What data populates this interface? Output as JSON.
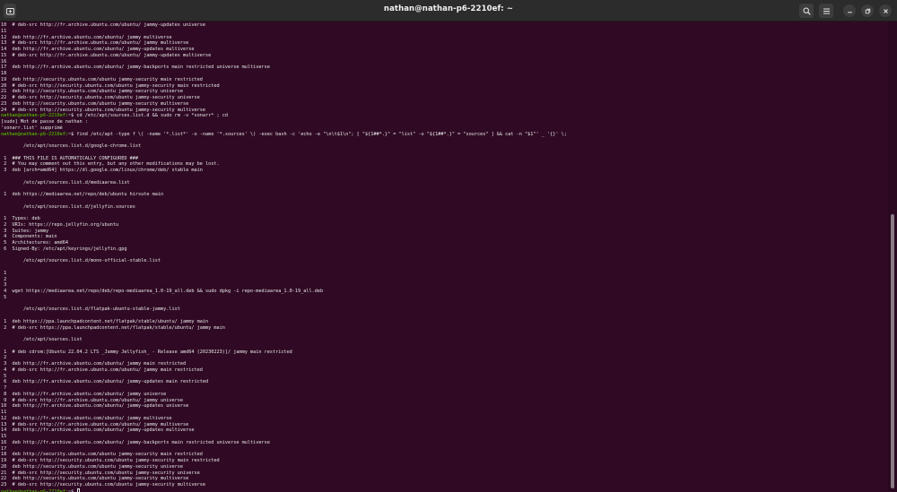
{
  "window": {
    "title": "nathan@nathan-p6-2210ef: ~",
    "icons": [
      "new-tab-icon",
      "search-icon",
      "menu-icon",
      "minimize-icon",
      "restore-icon",
      "close-icon"
    ]
  },
  "colors": {
    "background": "#300a24",
    "prompt": "#4e9a06",
    "text": "#e6e6e6"
  },
  "terminal": {
    "prompt": "nathan@nathan-p6-2210ef:",
    "lines": [
      {
        "text": "10  # deb-src http://fr.archive.ubuntu.com/ubuntu/ jammy-updates universe"
      },
      {
        "text": "11"
      },
      {
        "text": "12  deb http://fr.archive.ubuntu.com/ubuntu/ jammy multiverse"
      },
      {
        "text": "13  # deb-src http://fr.archive.ubuntu.com/ubuntu/ jammy multiverse"
      },
      {
        "text": "14  deb http://fr.archive.ubuntu.com/ubuntu/ jammy-updates multiverse"
      },
      {
        "text": "15  # deb-src http://fr.archive.ubuntu.com/ubuntu/ jammy-updates multiverse"
      },
      {
        "text": "16"
      },
      {
        "text": "17  deb http://fr.archive.ubuntu.com/ubuntu/ jammy-backports main restricted universe multiverse"
      },
      {
        "text": "18"
      },
      {
        "text": "19  deb http://security.ubuntu.com/ubuntu jammy-security main restricted"
      },
      {
        "text": "20  # deb-src http://security.ubuntu.com/ubuntu jammy-security main restricted"
      },
      {
        "text": "21  deb http://security.ubuntu.com/ubuntu jammy-security universe"
      },
      {
        "text": "22  # deb-src http://security.ubuntu.com/ubuntu jammy-security universe"
      },
      {
        "text": "23  deb http://security.ubuntu.com/ubuntu jammy-security multiverse"
      },
      {
        "text": "24  # deb-src http://security.ubuntu.com/ubuntu jammy-security multiverse"
      },
      {
        "prompt": "nathan@nathan-p6-2210ef:",
        "text": "~$ cd /etc/apt/sources.list.d && sudo rm -v *sonarr* ; cd"
      },
      {
        "text": "[sudo] Mot de passe de nathan :"
      },
      {
        "text": "'sonarr.list' supprimé"
      },
      {
        "prompt": "nathan@nathan-p6-2210ef:",
        "text": "~$ find /etc/apt -type f \\( -name '*.list*' -o -name '*.sources' \\) -exec bash -c 'echo -e \"\\n\\t$1\\n\"; [ \"${1##*.}\" = \"list\" -o \"${1##*.}\" = \"sources\" ] && cat -n \"$1\"' _ '{}' \\;"
      },
      {
        "text": ""
      },
      {
        "text": "        /etc/apt/sources.list.d/google-chrome.list"
      },
      {
        "text": ""
      },
      {
        "text": " 1  ### THIS FILE IS AUTOMATICALLY CONFIGURED ###"
      },
      {
        "text": " 2  # You may comment out this entry, but any other modifications may be lost."
      },
      {
        "text": " 3  deb [arch=amd64] https://dl.google.com/linux/chrome/deb/ stable main"
      },
      {
        "text": ""
      },
      {
        "text": "        /etc/apt/sources.list.d/mediaarea.list"
      },
      {
        "text": ""
      },
      {
        "text": " 1  deb https://mediaarea.net/repo/deb/ubuntu hirsute main"
      },
      {
        "text": ""
      },
      {
        "text": "        /etc/apt/sources.list.d/jellyfin.sources"
      },
      {
        "text": ""
      },
      {
        "text": " 1  Types: deb"
      },
      {
        "text": " 2  URIs: https://repo.jellyfin.org/ubuntu"
      },
      {
        "text": " 3  Suites: jammy"
      },
      {
        "text": " 4  Components: main"
      },
      {
        "text": " 5  Architectures: amd64"
      },
      {
        "text": " 6  Signed-By: /etc/apt/keyrings/jellyfin.gpg"
      },
      {
        "text": ""
      },
      {
        "text": "        /etc/apt/sources.list.d/mono-official-stable.list"
      },
      {
        "text": ""
      },
      {
        "text": " 1"
      },
      {
        "text": " 2"
      },
      {
        "text": " 3"
      },
      {
        "text": " 4  wget https://mediaarea.net/repo/deb/repo-mediaarea_1.0-19_all.deb && sudo dpkg -i repo-mediaarea_1.0-19_all.deb"
      },
      {
        "text": " 5"
      },
      {
        "text": ""
      },
      {
        "text": "        /etc/apt/sources.list.d/flatpak-ubuntu-stable-jammy.list"
      },
      {
        "text": ""
      },
      {
        "text": " 1  deb https://ppa.launchpadcontent.net/flatpak/stable/ubuntu/ jammy main"
      },
      {
        "text": " 2  # deb-src https://ppa.launchpadcontent.net/flatpak/stable/ubuntu/ jammy main"
      },
      {
        "text": ""
      },
      {
        "text": "        /etc/apt/sources.list"
      },
      {
        "text": ""
      },
      {
        "text": " 1  # deb cdrom:[Ubuntu 22.04.2 LTS _Jammy Jellyfish_ - Release amd64 (20230223)]/ jammy main restricted"
      },
      {
        "text": " 2"
      },
      {
        "text": " 3  deb http://fr.archive.ubuntu.com/ubuntu/ jammy main restricted"
      },
      {
        "text": " 4  # deb-src http://fr.archive.ubuntu.com/ubuntu/ jammy main restricted"
      },
      {
        "text": " 5"
      },
      {
        "text": " 6  deb http://fr.archive.ubuntu.com/ubuntu/ jammy-updates main restricted"
      },
      {
        "text": " 7"
      },
      {
        "text": " 8  deb http://fr.archive.ubuntu.com/ubuntu/ jammy universe"
      },
      {
        "text": " 9  # deb-src http://fr.archive.ubuntu.com/ubuntu/ jammy universe"
      },
      {
        "text": "10  deb http://fr.archive.ubuntu.com/ubuntu/ jammy-updates universe"
      },
      {
        "text": "11"
      },
      {
        "text": "12  deb http://fr.archive.ubuntu.com/ubuntu/ jammy multiverse"
      },
      {
        "text": "13  # deb-src http://fr.archive.ubuntu.com/ubuntu/ jammy multiverse"
      },
      {
        "text": "14  deb http://fr.archive.ubuntu.com/ubuntu/ jammy-updates multiverse"
      },
      {
        "text": "15"
      },
      {
        "text": "16  deb http://fr.archive.ubuntu.com/ubuntu/ jammy-backports main restricted universe multiverse"
      },
      {
        "text": "17"
      },
      {
        "text": "18  deb http://security.ubuntu.com/ubuntu jammy-security main restricted"
      },
      {
        "text": "19  # deb-src http://security.ubuntu.com/ubuntu jammy-security main restricted"
      },
      {
        "text": "20  deb http://security.ubuntu.com/ubuntu jammy-security universe"
      },
      {
        "text": "21  # deb-src http://security.ubuntu.com/ubuntu jammy-security universe"
      },
      {
        "text": "22  deb http://security.ubuntu.com/ubuntu jammy-security multiverse"
      },
      {
        "text": "23  # deb-src http://security.ubuntu.com/ubuntu jammy-security multiverse"
      },
      {
        "prompt": "nathan@nathan-p6-2210ef:",
        "text": "~$ ",
        "cursor": true
      }
    ]
  }
}
